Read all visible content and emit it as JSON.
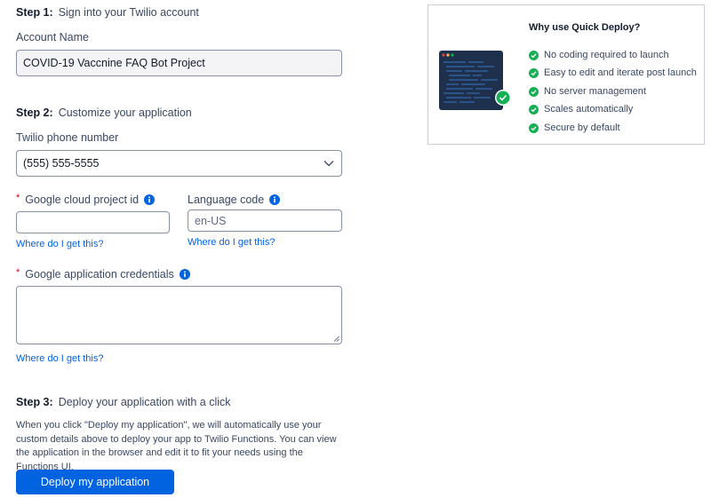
{
  "step1": {
    "number": "Step 1:",
    "title": "Sign into your Twilio account",
    "account_label": "Account Name",
    "account_value": "COVID-19 Vaccnine FAQ Bot Project"
  },
  "step2": {
    "number": "Step 2:",
    "title": "Customize your application",
    "phone_label": "Twilio phone number",
    "phone_value": "(555) 555-5555",
    "project_id_label": "Google cloud project id",
    "project_id_value": "",
    "project_id_help": "Where do I get this?",
    "language_label": "Language code",
    "language_placeholder": "en-US",
    "language_help": "Where do I get this?",
    "credentials_label": "Google application credentials",
    "credentials_value": "",
    "credentials_help": "Where do I get this?",
    "required_mark": "*"
  },
  "step3": {
    "number": "Step 3:",
    "title": "Deploy your application with a click",
    "description": "When you click \"Deploy my application\", we will automatically use your custom details above to deploy your app to Twilio Functions. You can view the application in the browser and edit it to fit your needs using the Functions UI.",
    "button_label": "Deploy my application"
  },
  "sidebar": {
    "title": "Why use Quick Deploy?",
    "benefits": [
      "No coding required to launch",
      "Easy to edit and iterate post launch",
      "No server management",
      "Scales automatically",
      "Secure by default"
    ]
  },
  "colors": {
    "primary_blue": "#0263e0",
    "success_green": "#14b053",
    "required_red": "#d6001c",
    "text": "#394762"
  }
}
